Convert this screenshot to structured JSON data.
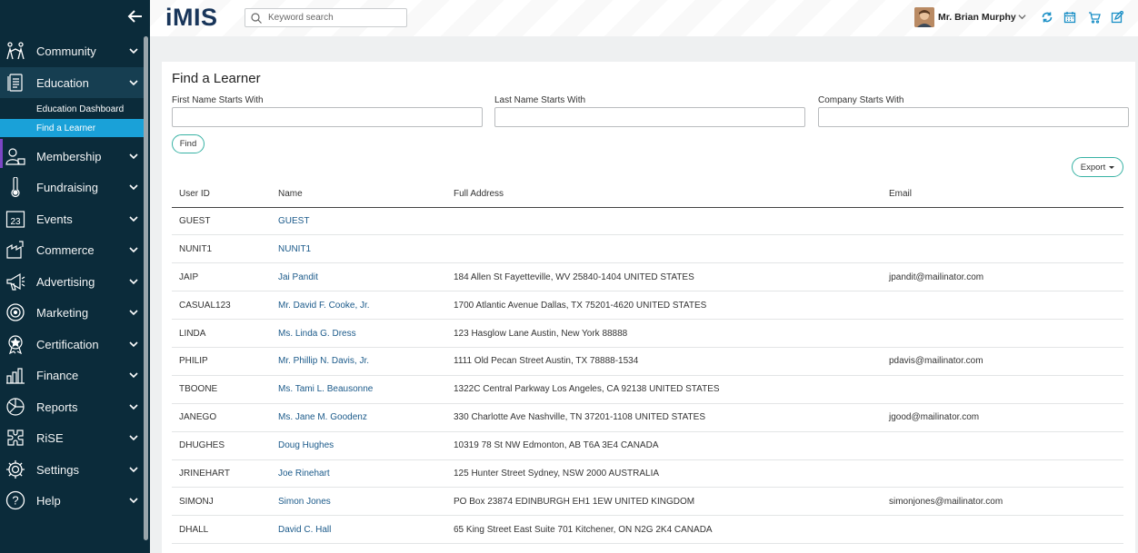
{
  "sidebar": {
    "items": [
      {
        "label": "Community",
        "icon": "community-icon"
      },
      {
        "label": "Education",
        "icon": "education-icon",
        "expanded": true,
        "children": [
          {
            "label": "Education Dashboard"
          },
          {
            "label": "Find a Learner",
            "selected": true
          }
        ]
      },
      {
        "label": "Membership",
        "icon": "membership-icon"
      },
      {
        "label": "Fundraising",
        "icon": "fundraising-icon"
      },
      {
        "label": "Events",
        "icon": "calendar-icon",
        "icon_text": "23"
      },
      {
        "label": "Commerce",
        "icon": "commerce-icon"
      },
      {
        "label": "Advertising",
        "icon": "megaphone-icon"
      },
      {
        "label": "Marketing",
        "icon": "target-icon"
      },
      {
        "label": "Certification",
        "icon": "badge-icon"
      },
      {
        "label": "Finance",
        "icon": "finance-icon"
      },
      {
        "label": "Reports",
        "icon": "reports-icon"
      },
      {
        "label": "RiSE",
        "icon": "puzzle-icon"
      },
      {
        "label": "Settings",
        "icon": "gear-icon"
      },
      {
        "label": "Help",
        "icon": "help-icon"
      }
    ]
  },
  "header": {
    "logo": "iMIS",
    "search_placeholder": "Keyword search",
    "user_name": "Mr. Brian Murphy",
    "icons": [
      "sync-icon",
      "calendar-icon",
      "cart-icon",
      "edit-icon"
    ]
  },
  "main": {
    "title": "Find a Learner",
    "filters": [
      {
        "label": "First Name Starts With",
        "value": ""
      },
      {
        "label": "Last Name Starts With",
        "value": ""
      },
      {
        "label": "Company Starts With",
        "value": ""
      }
    ],
    "find_label": "Find",
    "export_label": "Export",
    "columns": [
      "User ID",
      "Name",
      "Full Address",
      "Email"
    ],
    "rows": [
      [
        "GUEST",
        "GUEST",
        "",
        ""
      ],
      [
        "NUNIT1",
        "NUNIT1",
        "",
        ""
      ],
      [
        "JAIP",
        "Jai Pandit",
        "184 Allen St Fayetteville, WV 25840-1404 UNITED STATES",
        "jpandit@mailinator.com"
      ],
      [
        "CASUAL123",
        "Mr. David F. Cooke, Jr.",
        "1700 Atlantic Avenue Dallas, TX 75201-4620 UNITED STATES",
        ""
      ],
      [
        "LINDA",
        "Ms. Linda G. Dress",
        "123 Hasglow Lane Austin, New York 88888",
        ""
      ],
      [
        "PHILIP",
        "Mr. Phillip N. Davis, Jr.",
        "1111 Old Pecan Street Austin, TX 78888-1534",
        "pdavis@mailinator.com"
      ],
      [
        "TBOONE",
        "Ms. Tami L. Beausonne",
        "1322C Central Parkway Los Angeles, CA 92138 UNITED STATES",
        ""
      ],
      [
        "JANEGO",
        "Ms. Jane M. Goodenz",
        "330 Charlotte Ave Nashville, TN 37201-1108 UNITED STATES",
        "jgood@mailinator.com"
      ],
      [
        "DHUGHES",
        "Doug Hughes",
        "10319 78 St NW Edmonton, AB T6A 3E4 CANADA",
        ""
      ],
      [
        "JRINEHART",
        "Joe Rinehart",
        "125 Hunter Street Sydney, NSW 2000 AUSTRALIA",
        ""
      ],
      [
        "SIMONJ",
        "Simon Jones",
        "PO Box 23874 EDINBURGH EH1 1EW UNITED KINGDOM",
        "simonjones@mailinator.com"
      ],
      [
        "DHALL",
        "David C. Hall",
        "65 King Street East Suite 701 Kitchener, ON N2G 2K4 CANADA",
        ""
      ]
    ]
  },
  "colors": {
    "sidebar_bg": "#0b2b3a",
    "selected_bg": "#1aa1d8",
    "accent_purple": "#7b46c4",
    "button_border": "#37b2a4",
    "link": "#1b5a8a",
    "logo": "#18355a"
  }
}
